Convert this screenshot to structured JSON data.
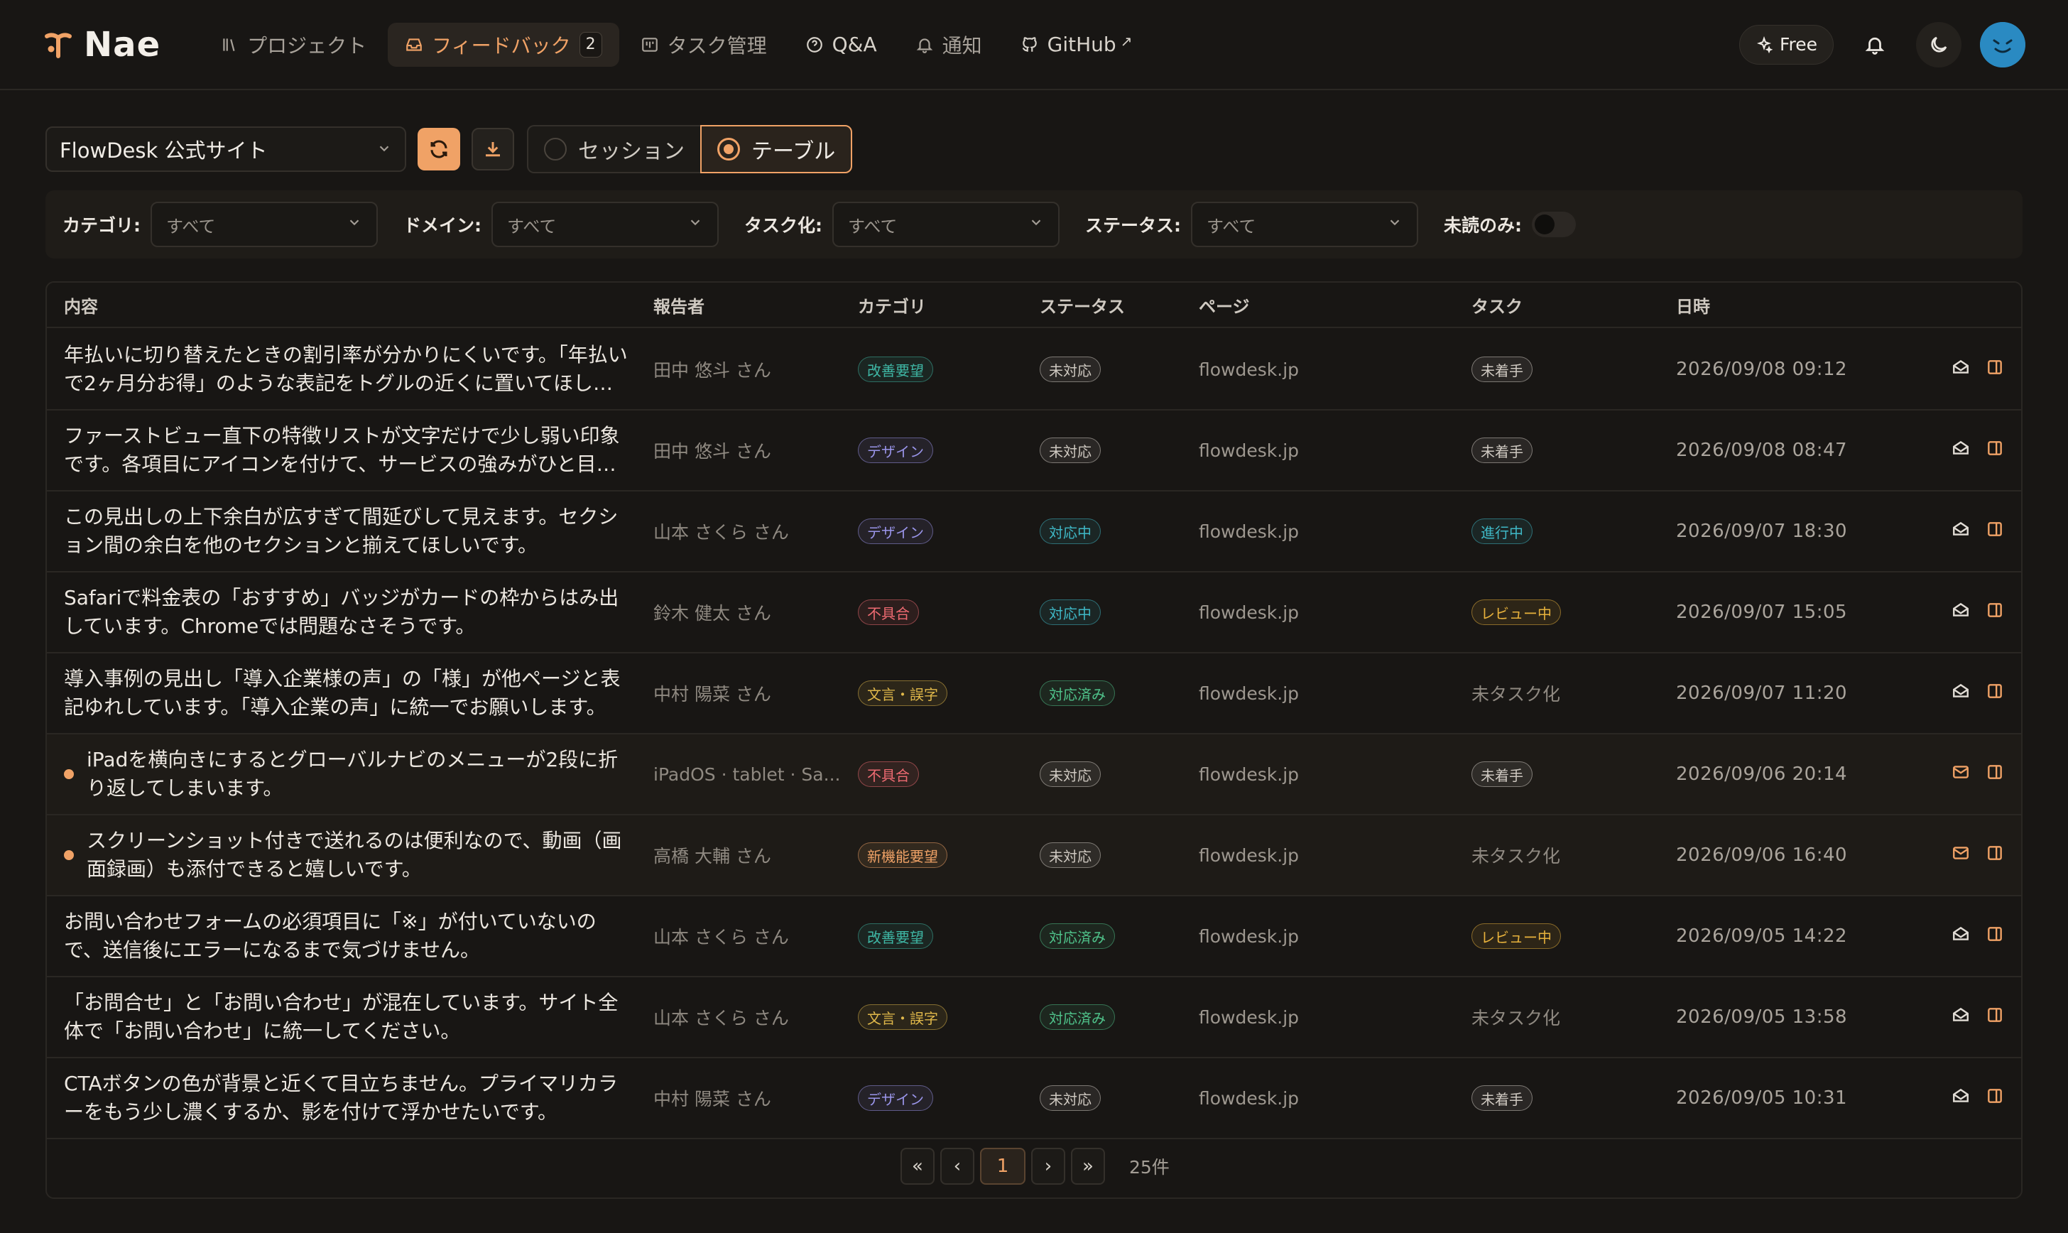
{
  "app": {
    "name": "Nae"
  },
  "nav": [
    {
      "label": "プロジェクト",
      "icon": "library-icon"
    },
    {
      "label": "フィードバック",
      "icon": "inbox-icon",
      "badge": "2",
      "active": true
    },
    {
      "label": "タスク管理",
      "icon": "kanban-icon"
    },
    {
      "label": "Q&A",
      "icon": "help-circle-icon"
    },
    {
      "label": "通知",
      "icon": "bell-icon"
    },
    {
      "label": "GitHub",
      "icon": "github-icon",
      "external": "↗"
    }
  ],
  "header": {
    "plan_label": "Free"
  },
  "toolbar": {
    "project": "FlowDesk 公式サイト",
    "view_session": "セッション",
    "view_table": "テーブル",
    "selected_view": "テーブル"
  },
  "filters": {
    "category_label": "カテゴリ:",
    "category_value": "すべて",
    "domain_label": "ドメイン:",
    "domain_value": "すべて",
    "tasked_label": "タスク化:",
    "tasked_value": "すべて",
    "status_label": "ステータス:",
    "status_value": "すべて",
    "unread_label": "未読のみ:"
  },
  "table": {
    "headers": [
      "内容",
      "報告者",
      "カテゴリ",
      "ステータス",
      "ページ",
      "タスク",
      "日時"
    ],
    "rows": [
      {
        "unread": false,
        "content": "年払いに切り替えたときの割引率が分かりにくいです。「年払いで2ヶ月分お得」のような表記をトグルの近くに置いてほしいです。",
        "reporter": "田中 悠斗 さん",
        "category": "改善要望",
        "status": "未対応",
        "page": "flowdesk.jp",
        "task": "未着手",
        "task_badge": true,
        "date": "2026/09/08 09:12"
      },
      {
        "unread": false,
        "content": "ファーストビュー直下の特徴リストが文字だけで少し弱い印象です。各項目にアイコンを付けて、サービスの強みがひと目で分かるようにしたいです。",
        "reporter": "田中 悠斗 さん",
        "category": "デザイン",
        "status": "未対応",
        "page": "flowdesk.jp",
        "task": "未着手",
        "task_badge": true,
        "date": "2026/09/08 08:47"
      },
      {
        "unread": false,
        "content": "この見出しの上下余白が広すぎて間延びして見えます。セクション間の余白を他のセクションと揃えてほしいです。",
        "reporter": "山本 さくら さん",
        "category": "デザイン",
        "status": "対応中",
        "page": "flowdesk.jp",
        "task": "進行中",
        "task_badge": true,
        "date": "2026/09/07 18:30"
      },
      {
        "unread": false,
        "content": "Safariで料金表の「おすすめ」バッジがカードの枠からはみ出しています。Chromeでは問題なさそうです。",
        "reporter": "鈴木 健太 さん",
        "category": "不具合",
        "status": "対応中",
        "page": "flowdesk.jp",
        "task": "レビュー中",
        "task_badge": true,
        "date": "2026/09/07 15:05"
      },
      {
        "unread": false,
        "content": "導入事例の見出し「導入企業様の声」の「様」が他ページと表記ゆれしています。「導入企業の声」に統一でお願いします。",
        "reporter": "中村 陽菜 さん",
        "category": "文言・誤字",
        "status": "対応済み",
        "page": "flowdesk.jp",
        "task": "未タスク化",
        "task_badge": false,
        "date": "2026/09/07 11:20"
      },
      {
        "unread": true,
        "content": "iPadを横向きにするとグローバルナビのメニューが2段に折り返してしまいます。",
        "reporter": "iPadOS · tablet · Sa...",
        "category": "不具合",
        "status": "未対応",
        "page": "flowdesk.jp",
        "task": "未着手",
        "task_badge": true,
        "date": "2026/09/06 20:14"
      },
      {
        "unread": true,
        "content": "スクリーンショット付きで送れるのは便利なので、動画（画面録画）も添付できると嬉しいです。",
        "reporter": "高橋 大輔 さん",
        "category": "新機能要望",
        "status": "未対応",
        "page": "flowdesk.jp",
        "task": "未タスク化",
        "task_badge": false,
        "date": "2026/09/06 16:40"
      },
      {
        "unread": false,
        "content": "お問い合わせフォームの必須項目に「※」が付いていないので、送信後にエラーになるまで気づけません。",
        "reporter": "山本 さくら さん",
        "category": "改善要望",
        "status": "対応済み",
        "page": "flowdesk.jp",
        "task": "レビュー中",
        "task_badge": true,
        "date": "2026/09/05 14:22"
      },
      {
        "unread": false,
        "content": "「お問合せ」と「お問い合わせ」が混在しています。サイト全体で「お問い合わせ」に統一してください。",
        "reporter": "山本 さくら さん",
        "category": "文言・誤字",
        "status": "対応済み",
        "page": "flowdesk.jp",
        "task": "未タスク化",
        "task_badge": false,
        "date": "2026/09/05 13:58"
      },
      {
        "unread": false,
        "content": "CTAボタンの色が背景と近くて目立ちません。プライマリカラーをもう少し濃くするか、影を付けて浮かせたいです。",
        "reporter": "中村 陽菜 さん",
        "category": "デザイン",
        "status": "未対応",
        "page": "flowdesk.jp",
        "task": "未着手",
        "task_badge": true,
        "date": "2026/09/05 10:31"
      }
    ]
  },
  "pagination": {
    "first": "«",
    "prev": "‹",
    "current": "1",
    "next": "›",
    "last": "»",
    "total": "25件"
  },
  "colors": {
    "accent": "#f0a266",
    "category": {
      "改善要望": "#3fb8a6",
      "デザイン": "#9a95ea",
      "不具合": "#ef6b72",
      "文言・誤字": "#e0b84a",
      "新機能要望": "#f0a266"
    },
    "status": {
      "未対応": "#cfc9c1",
      "対応中": "#3fb8c6",
      "対応済み": "#4fc28a"
    },
    "task": {
      "未着手": "#cfc9c1",
      "進行中": "#3fb8c6",
      "レビュー中": "#e8b23c"
    }
  }
}
